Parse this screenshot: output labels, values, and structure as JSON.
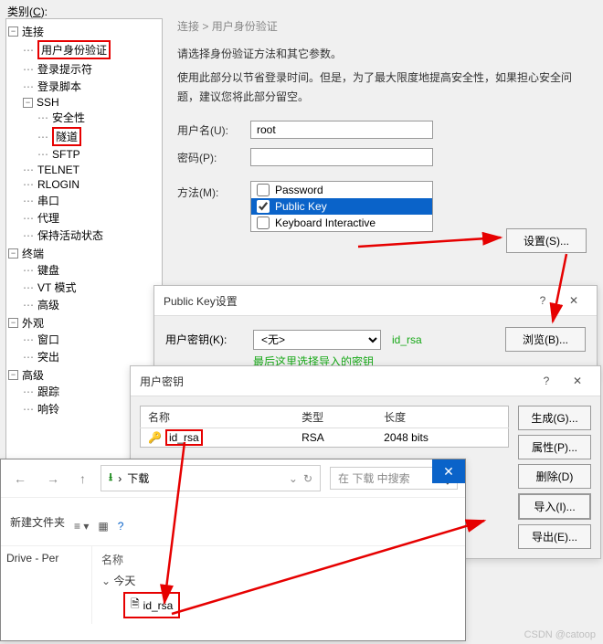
{
  "labels": {
    "category": "类别",
    "category_key": "C"
  },
  "tree": {
    "n_connection": "连接",
    "n_userauth": "用户身份验证",
    "n_loginprompt": "登录提示符",
    "n_loginscript": "登录脚本",
    "n_ssh": "SSH",
    "n_security": "安全性",
    "n_tunnel": "隧道",
    "n_sftp": "SFTP",
    "n_telnet": "TELNET",
    "n_rlogin": "RLOGIN",
    "n_serial": "串口",
    "n_proxy": "代理",
    "n_keepalive": "保持活动状态",
    "n_terminal": "终端",
    "n_keyboard": "键盘",
    "n_vtmode": "VT 模式",
    "n_advanced_t": "高级",
    "n_appearance": "外观",
    "n_window": "窗口",
    "n_highlight": "突出",
    "n_advanced": "高级",
    "n_track": "跟踪",
    "n_bell": "响铃"
  },
  "right": {
    "crumb1": "连接",
    "crumb_sep": ">",
    "crumb2": "用户身份验证",
    "line1": "请选择身份验证方法和其它参数。",
    "line2": "使用此部分以节省登录时间。但是，为了最大限度地提高安全性，如果担心安全问题，建议您将此部分留空。",
    "lbl_user": "用户名(U):",
    "val_user": "root",
    "lbl_pass": "密码(P):",
    "val_pass": "",
    "lbl_method": "方法(M):",
    "m_password": "Password",
    "m_publickey": "Public Key",
    "m_kbd": "Keyboard Interactive",
    "btn_settings": "设置(S)..."
  },
  "dlg_pk": {
    "title": "Public Key设置",
    "lbl_userkey": "用户密钥(K):",
    "sel_none": "<无>",
    "ann1": "id_rsa",
    "ann2": "最后这里选择导入的密钥",
    "btn_browse": "浏览(B)..."
  },
  "dlg_uk": {
    "title": "用户密钥",
    "col_name": "名称",
    "col_type": "类型",
    "col_len": "长度",
    "row_name": "id_rsa",
    "row_type": "RSA",
    "row_len": "2048 bits",
    "btn_gen": "生成(G)...",
    "btn_prop": "属性(P)...",
    "btn_del": "删除(D)",
    "btn_import": "导入(I)...",
    "btn_export": "导出(E)..."
  },
  "dlg_fb": {
    "crumb": "下载",
    "search_ph": "在 下载 中搜索",
    "newfolder": "新建文件夹",
    "side1": "Drive - Per",
    "col_name": "名称",
    "grp_today": "今天",
    "file": "id_rsa"
  },
  "watermark": "CSDN @catoop"
}
